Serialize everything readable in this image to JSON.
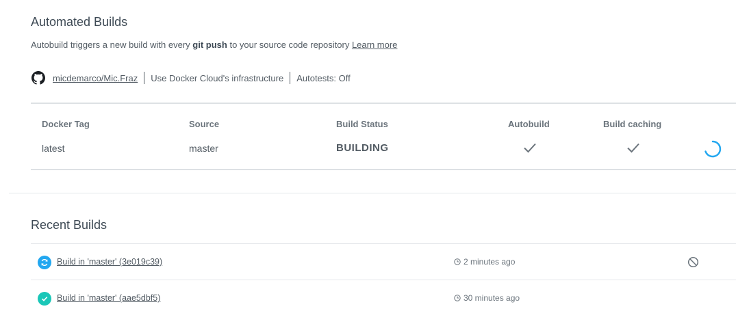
{
  "automated": {
    "title": "Automated Builds",
    "desc_prefix": "Autobuild triggers a new build with every ",
    "desc_bold": "git push",
    "desc_suffix": " to your source code repository ",
    "learn_more": "Learn more",
    "repo": "micdemarco/Mic.Fraz",
    "infra": "Use Docker Cloud's infrastructure",
    "autotests": "Autotests: Off",
    "icons": {
      "repo": "github-icon",
      "autobuild": "check-icon",
      "caching": "check-icon",
      "status": "spinner-icon"
    }
  },
  "tag_table": {
    "headers": {
      "tag": "Docker Tag",
      "source": "Source",
      "status": "Build Status",
      "autobuild": "Autobuild",
      "caching": "Build caching"
    },
    "row": {
      "tag": "latest",
      "source": "master",
      "status": "BUILDING"
    }
  },
  "recent": {
    "title": "Recent Builds",
    "builds": [
      {
        "name": "Build in 'master' (3e019c39)",
        "time": "2 minutes ago",
        "state": "building",
        "icon": "refresh-icon",
        "color": "#22a7f0"
      },
      {
        "name": "Build in 'master' (aae5dbf5)",
        "time": "30 minutes ago",
        "state": "success",
        "icon": "check-circle-icon",
        "color": "#1ac7b8"
      }
    ]
  },
  "colors": {
    "spinner": "#22a7f0",
    "text": "#525b63",
    "border": "#dde1e4"
  }
}
